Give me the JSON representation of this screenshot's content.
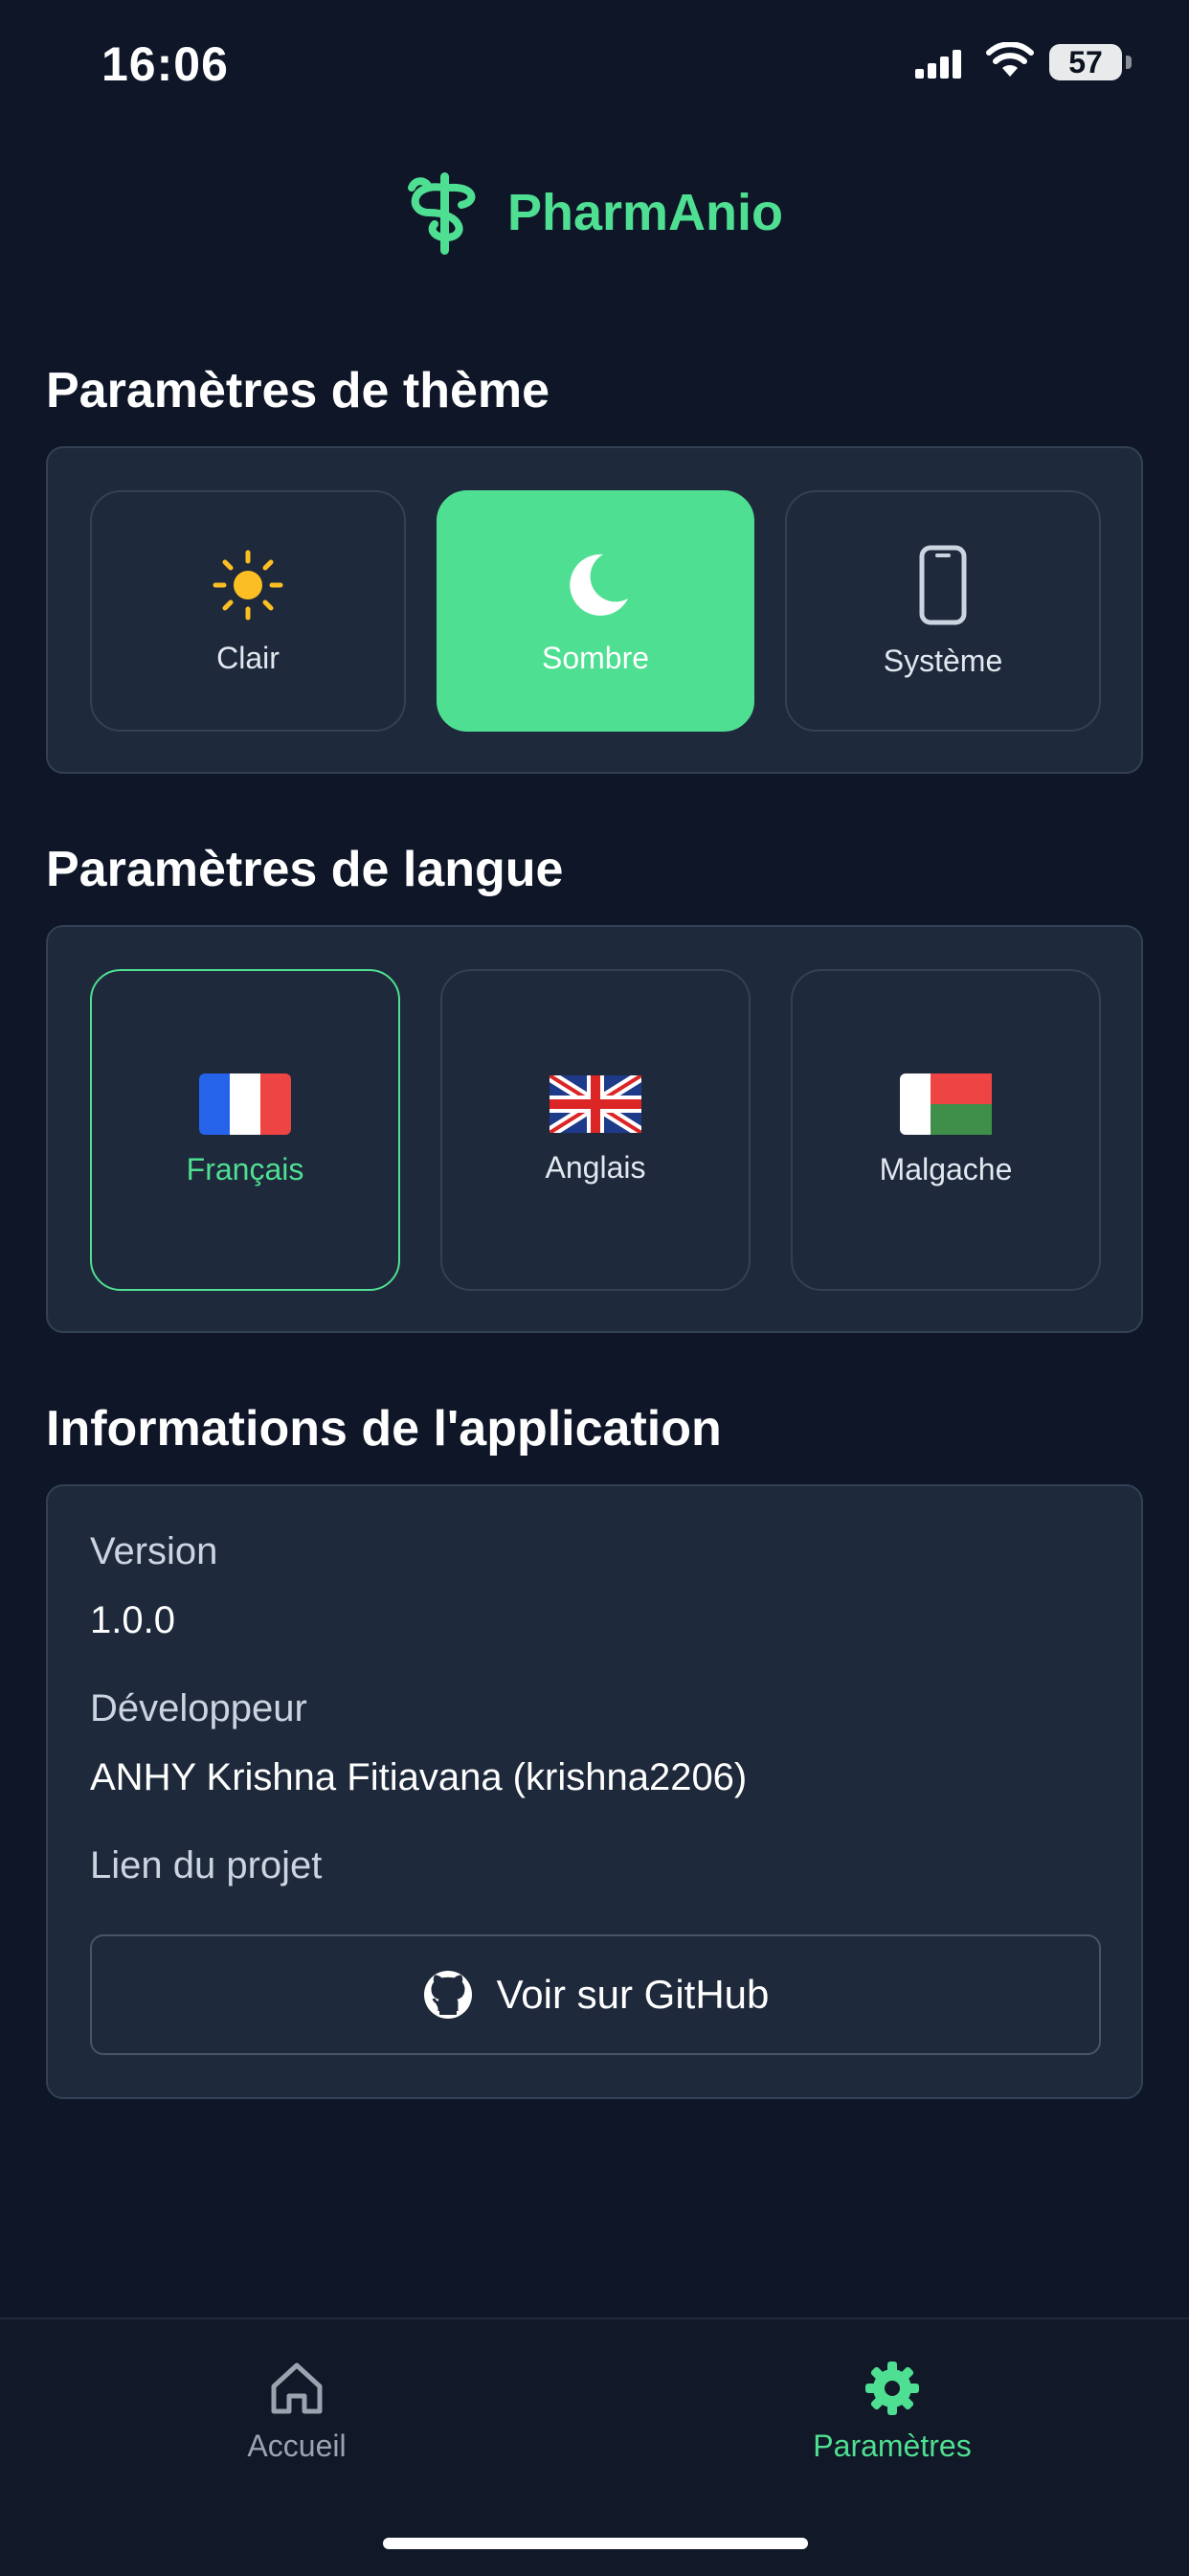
{
  "status_bar": {
    "time": "16:06",
    "battery": "57"
  },
  "brand": {
    "name": "PharmAnio",
    "color": "#4fdf92"
  },
  "theme_section": {
    "title": "Paramètres de thème",
    "options": [
      {
        "label": "Clair",
        "icon": "sun-icon"
      },
      {
        "label": "Sombre",
        "icon": "moon-icon",
        "selected": true
      },
      {
        "label": "Système",
        "icon": "phone-icon"
      }
    ]
  },
  "language_section": {
    "title": "Paramètres de langue",
    "options": [
      {
        "label": "Français",
        "icon": "flag-france-icon",
        "selected": true
      },
      {
        "label": "Anglais",
        "icon": "flag-uk-icon"
      },
      {
        "label": "Malgache",
        "icon": "flag-madagascar-icon"
      }
    ]
  },
  "info_section": {
    "title": "Informations de l'application",
    "version_label": "Version",
    "version_value": "1.0.0",
    "developer_label": "Développeur",
    "developer_value": "ANHY Krishna Fitiavana (krishna2206)",
    "project_link_label": "Lien du projet",
    "github_button": "Voir sur GitHub"
  },
  "tab_bar": {
    "tabs": [
      {
        "label": "Accueil",
        "icon": "home-icon"
      },
      {
        "label": "Paramètres",
        "icon": "gear-icon",
        "active": true
      }
    ]
  },
  "colors": {
    "accent": "#4fdf92",
    "background": "#0e1628",
    "card": "#1e293b"
  }
}
